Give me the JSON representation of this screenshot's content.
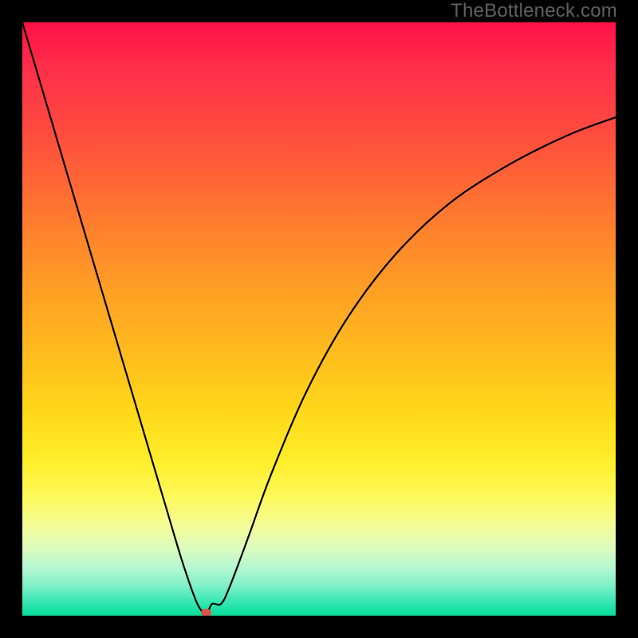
{
  "watermark": "TheBottleneck.com",
  "chart_data": {
    "type": "line",
    "title": "",
    "xlabel": "",
    "ylabel": "",
    "xlim": [
      0,
      100
    ],
    "ylim": [
      0,
      100
    ],
    "grid": false,
    "series": [
      {
        "name": "curve",
        "x": [
          0,
          4,
          8,
          12,
          16,
          20,
          24,
          27,
          29.5,
          31,
          32,
          33.5,
          35,
          38,
          42,
          48,
          55,
          63,
          72,
          82,
          92,
          100
        ],
        "y": [
          100,
          86.5,
          73,
          59.5,
          46,
          32.5,
          19,
          9,
          2,
          0.5,
          2,
          2,
          5,
          13,
          24,
          38,
          50.5,
          61,
          69.5,
          76,
          81,
          84
        ]
      }
    ],
    "marker": {
      "x": 31,
      "y": 0.5,
      "color": "#d9544f"
    },
    "background_gradient": {
      "stops": [
        {
          "pos": 0,
          "color": "#ff1147"
        },
        {
          "pos": 18,
          "color": "#ff4a3f"
        },
        {
          "pos": 38,
          "color": "#ff8a2a"
        },
        {
          "pos": 58,
          "color": "#ffc21c"
        },
        {
          "pos": 74,
          "color": "#ffee2a"
        },
        {
          "pos": 85,
          "color": "#f3fc9a"
        },
        {
          "pos": 95,
          "color": "#7ef0c8"
        },
        {
          "pos": 100,
          "color": "#0bdc98"
        }
      ]
    }
  }
}
